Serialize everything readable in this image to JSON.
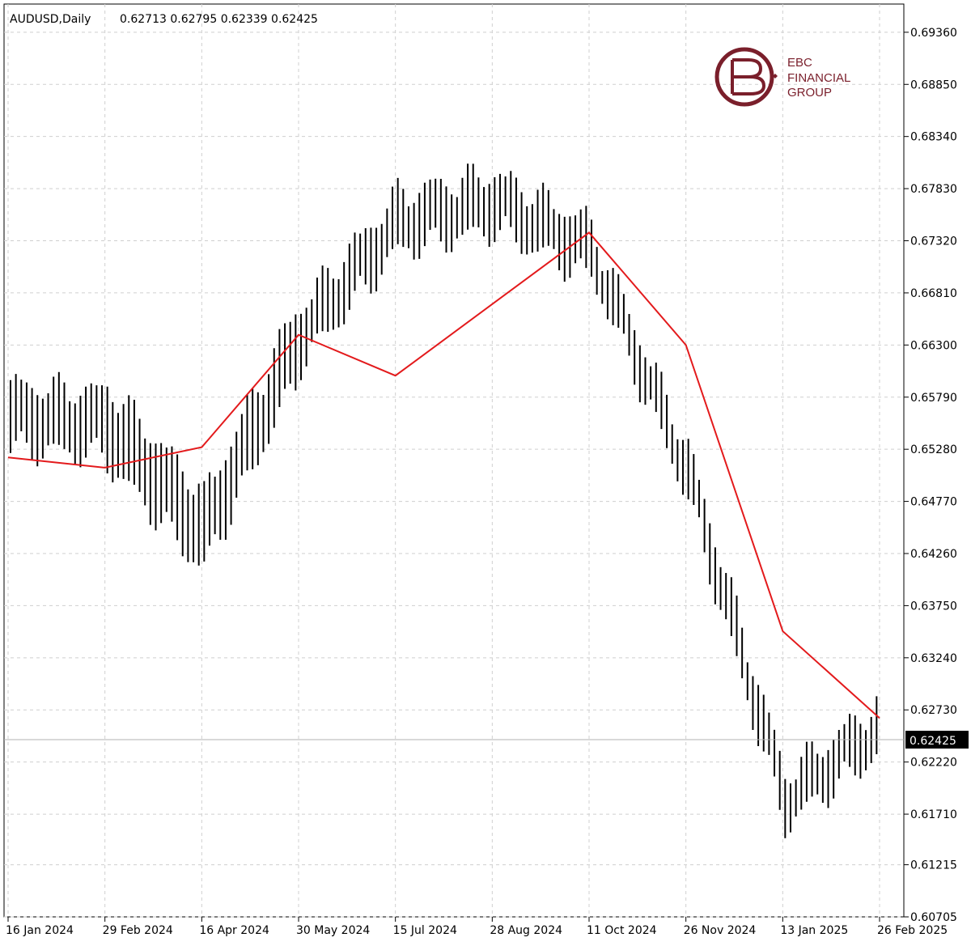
{
  "header": {
    "symbol": "AUDUSD,Daily",
    "ohlc": "0.62713 0.62795 0.62339 0.62425"
  },
  "logo": {
    "line1": "EBC",
    "line2": "FINANCIAL",
    "line3": "GROUP",
    "color": "#7a1f2b"
  },
  "chart_data": {
    "type": "ohlc",
    "title": "AUDUSD,Daily",
    "ohlc_last": {
      "open": 0.62713,
      "high": 0.62795,
      "low": 0.62339,
      "close": 0.62425
    },
    "current_price_label": "0.62425",
    "current_price": 0.62425,
    "ylim": [
      0.60705,
      0.69636
    ],
    "y_ticks": [
      "0.69360",
      "0.68850",
      "0.68340",
      "0.67830",
      "0.67320",
      "0.66810",
      "0.66300",
      "0.65790",
      "0.65280",
      "0.64770",
      "0.64260",
      "0.63750",
      "0.63240",
      "0.62730",
      "0.62220",
      "0.61710",
      "0.61215",
      "0.60705"
    ],
    "x_ticks": [
      "16 Jan 2024",
      "29 Feb 2024",
      "16 Apr 2024",
      "30 May 2024",
      "15 Jul 2024",
      "28 Aug 2024",
      "11 Oct 2024",
      "26 Nov 2024",
      "13 Jan 2025",
      "26 Feb 2025"
    ],
    "grid": true,
    "series": [
      {
        "type": "ohlc",
        "color": "#000000",
        "points": [
          {
            "x": "16 Jan 2024",
            "low": 0.653,
            "high": 0.659
          },
          {
            "x": "29 Feb 2024",
            "low": 0.649,
            "high": 0.6615
          },
          {
            "x": "16 Apr 2024",
            "low": 0.639,
            "high": 0.6505
          },
          {
            "x": "30 May 2024",
            "low": 0.659,
            "high": 0.669
          },
          {
            "x": "15 Jul 2024",
            "low": 0.672,
            "high": 0.678
          },
          {
            "x": "28 Aug 2024",
            "low": 0.672,
            "high": 0.682
          },
          {
            "x": "11 Oct 2024",
            "low": 0.6695,
            "high": 0.675
          },
          {
            "x": "26 Nov 2024",
            "low": 0.647,
            "high": 0.654
          },
          {
            "x": "13 Jan 2025",
            "low": 0.615,
            "high": 0.622
          },
          {
            "x": "26 Feb 2025",
            "low": 0.6225,
            "high": 0.629
          }
        ]
      },
      {
        "type": "line",
        "color": "#e31a1c",
        "x": [
          "16 Jan 2024",
          "29 Feb 2024",
          "16 Apr 2024",
          "30 May 2024",
          "15 Jul 2024",
          "28 Aug 2024",
          "11 Oct 2024",
          "26 Nov 2024",
          "13 Jan 2025",
          "26 Feb 2025"
        ],
        "values": [
          0.652,
          0.651,
          0.653,
          0.664,
          0.66,
          0.667,
          0.674,
          0.663,
          0.635,
          0.6265
        ]
      }
    ]
  }
}
